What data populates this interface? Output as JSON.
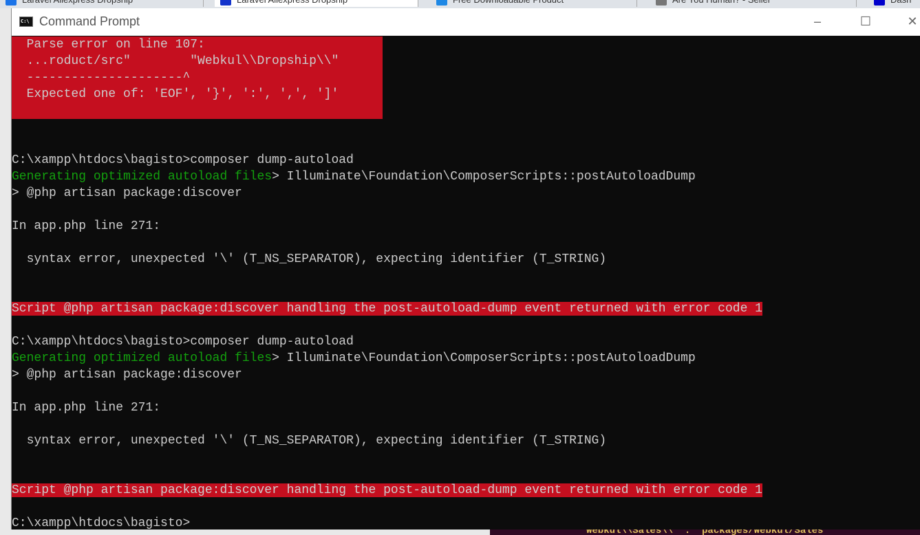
{
  "browser_tabs": [
    {
      "label": "Laravel Aliexpress Dropship",
      "color": "#1a73e8"
    },
    {
      "label": "Laravel Aliexpress Dropship",
      "color": "#1434cb"
    },
    {
      "label": "Free Downloadable Product",
      "color": "#1e88e5"
    },
    {
      "label": "Are You Human? - Seller",
      "color": "#777777"
    },
    {
      "label": "Dash",
      "color": "#0000cc"
    }
  ],
  "window": {
    "title": "Command Prompt",
    "icon": "cmd-icon",
    "minimize": "–",
    "maximize": "☐",
    "close": "✕"
  },
  "colors": {
    "error_bg": "#c50f1f",
    "green": "#13a10e",
    "text": "#cccccc",
    "background": "#0c0c0c"
  },
  "lines": [
    {
      "text": "  Parse error on line 107:",
      "type": "box"
    },
    {
      "text": "  ...roduct/src\"        \"Webkul\\\\Dropship\\\\\"",
      "type": "box"
    },
    {
      "text": "  ---------------------^",
      "type": "box"
    },
    {
      "text": "  Expected one of: 'EOF', '}', ':', ',', ']'",
      "type": "box"
    },
    {
      "text": "",
      "type": "normal"
    },
    {
      "text": "",
      "type": "normal"
    },
    {
      "text": "",
      "type": "normal"
    },
    {
      "text": "C:\\xampp\\htdocs\\bagisto>composer dump-autoload",
      "type": "normal"
    },
    {
      "green": "Generating optimized autoload files",
      "text": "> Illuminate\\Foundation\\ComposerScripts::postAutoloadDump",
      "type": "green"
    },
    {
      "text": "> @php artisan package:discover",
      "type": "normal"
    },
    {
      "text": "",
      "type": "normal"
    },
    {
      "text": "In app.php line 271:",
      "type": "normal"
    },
    {
      "text": "",
      "type": "normal"
    },
    {
      "text": "  syntax error, unexpected '\\' (T_NS_SEPARATOR), expecting identifier (T_STRING)",
      "type": "normal"
    },
    {
      "text": "",
      "type": "normal"
    },
    {
      "text": "",
      "type": "normal"
    },
    {
      "text": "Script @php artisan package:discover handling the post-autoload-dump event returned with error code 1",
      "type": "red"
    },
    {
      "text": "",
      "type": "normal"
    },
    {
      "text": "C:\\xampp\\htdocs\\bagisto>composer dump-autoload",
      "type": "normal"
    },
    {
      "green": "Generating optimized autoload files",
      "text": "> Illuminate\\Foundation\\ComposerScripts::postAutoloadDump",
      "type": "green"
    },
    {
      "text": "> @php artisan package:discover",
      "type": "normal"
    },
    {
      "text": "",
      "type": "normal"
    },
    {
      "text": "In app.php line 271:",
      "type": "normal"
    },
    {
      "text": "",
      "type": "normal"
    },
    {
      "text": "  syntax error, unexpected '\\' (T_NS_SEPARATOR), expecting identifier (T_STRING)",
      "type": "normal"
    },
    {
      "text": "",
      "type": "normal"
    },
    {
      "text": "",
      "type": "normal"
    },
    {
      "text": "Script @php artisan package:discover handling the post-autoload-dump event returned with error code 1",
      "type": "red"
    },
    {
      "text": "",
      "type": "normal"
    },
    {
      "text": "C:\\xampp\\htdocs\\bagisto>",
      "type": "normal"
    }
  ],
  "background_window_text": "Webkul\\\\Sales\\\\\" : \"packages/Webkul/Sales"
}
